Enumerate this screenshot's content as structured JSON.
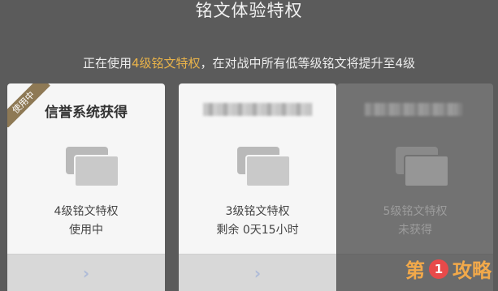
{
  "header": {
    "title": "铭文体验特权",
    "subtitle_prefix": "正在使用",
    "subtitle_highlight": "4级铭文特权",
    "subtitle_suffix": "，在对战中所有低等级铭文将提升至4级",
    "highlight_color": "#e9b34a"
  },
  "cards": [
    {
      "ribbon": "使用中",
      "title": "信誉系统获得",
      "level": "4级铭文特权",
      "status": "使用中",
      "arrow_icon": "chevron-right-icon"
    },
    {
      "level": "3级铭文特权",
      "status": "剩余 0天15小时",
      "arrow_icon": "chevron-right-icon"
    },
    {
      "level": "5级铭文特权",
      "status": "未获得"
    }
  ],
  "watermark": {
    "part1": "第",
    "part2": "1",
    "part3": "攻略"
  }
}
